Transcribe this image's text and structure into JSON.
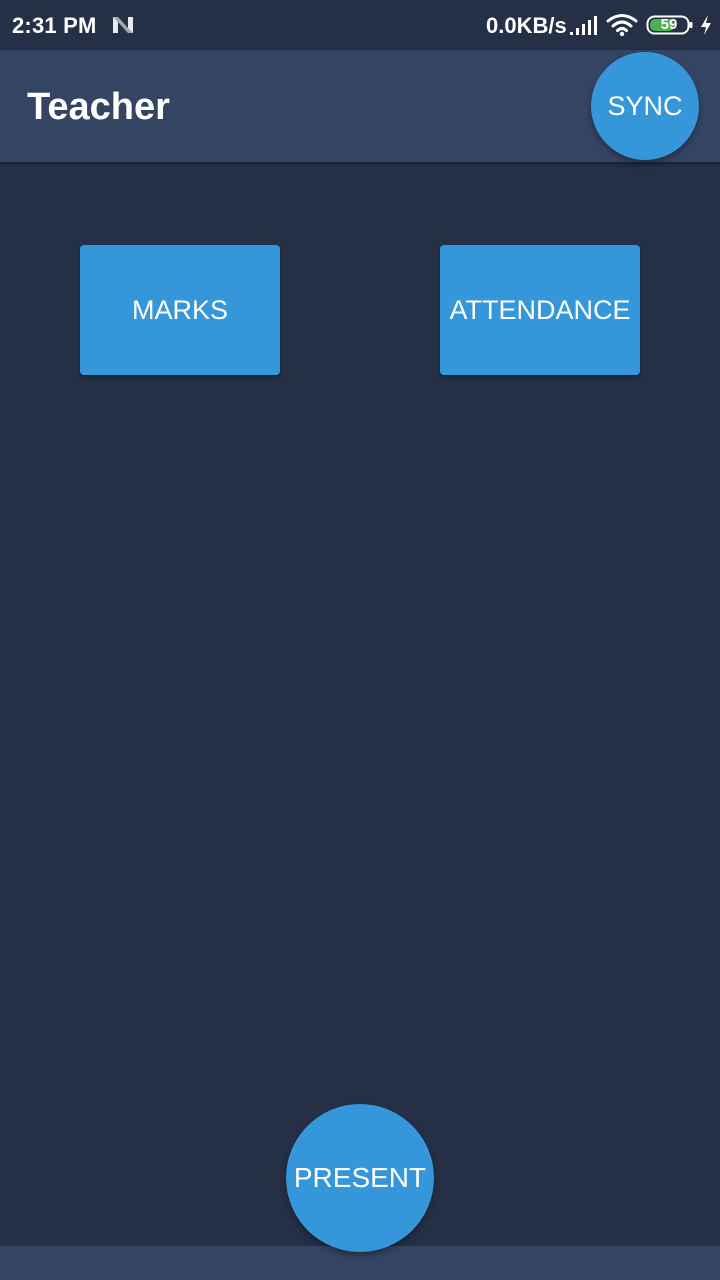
{
  "status_bar": {
    "time": "2:31 PM",
    "net_speed": "0.0KB/s",
    "battery_level": "59",
    "icons": [
      "notification-n-icon",
      "signal-icon",
      "wifi-icon",
      "battery-icon",
      "charging-bolt-icon"
    ]
  },
  "app_bar": {
    "title": "Teacher",
    "sync_label": "SYNC"
  },
  "main": {
    "marks_label": "MARKS",
    "attendance_label": "ATTENDANCE"
  },
  "fab": {
    "present_label": "PRESENT"
  },
  "colors": {
    "background": "#253046",
    "app_bar": "#344463",
    "accent": "#3596da",
    "text": "#ffffff",
    "battery_fill": "#4caf50"
  }
}
